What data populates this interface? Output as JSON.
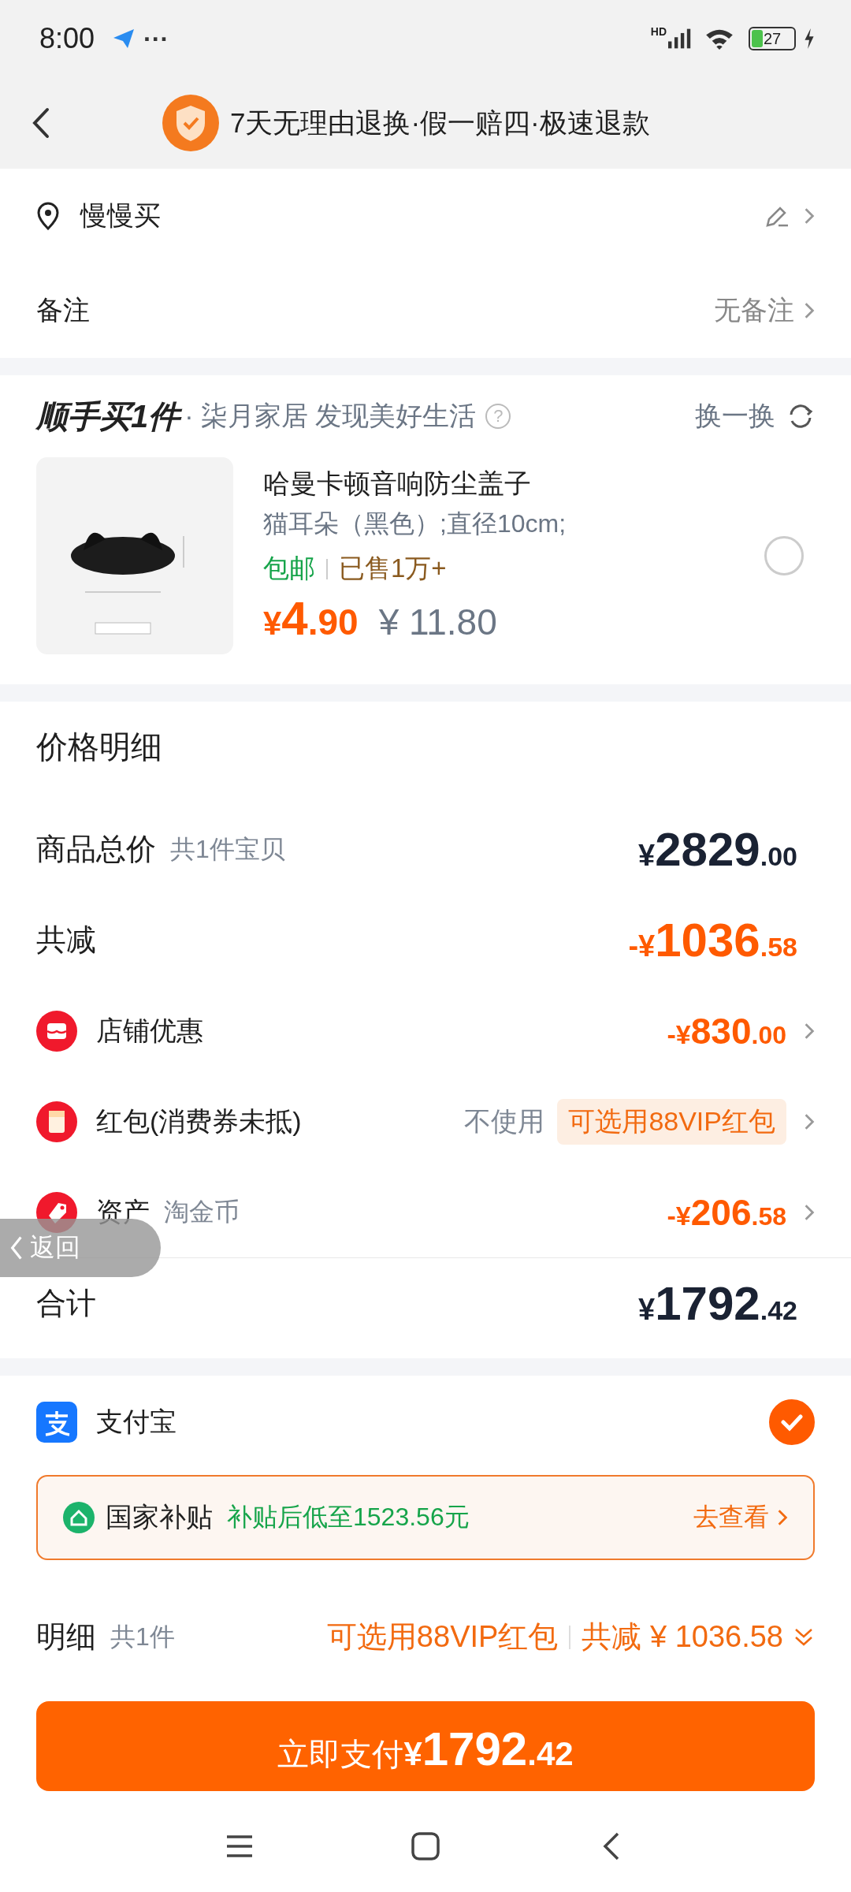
{
  "status_bar": {
    "time": "8:00",
    "more": "···",
    "network_label": "HD",
    "battery": "27"
  },
  "header": {
    "title": "7天无理由退换·假一赔四·极速退款"
  },
  "address": {
    "name": "慢慢买"
  },
  "remark": {
    "label": "备注",
    "value": "无备注"
  },
  "add_on": {
    "brand": "顺手买1件",
    "shop": "· 柒月家居 发现美好生活",
    "help": "?",
    "refresh": "换一换",
    "product": {
      "title": "哈曼卡顿音响防尘盖子",
      "spec": "猫耳朵（黑色）;直径10cm;",
      "shipping": "包邮",
      "sold": "已售1万+",
      "price": {
        "sign": "¥",
        "int": "4",
        "dec": ".90"
      },
      "original_price": "¥ 11.80",
      "selected": false
    }
  },
  "price_detail": {
    "title": "价格明细",
    "rows": [
      {
        "kind": "total",
        "label": "商品总价",
        "note": "共1件宝贝",
        "amount": {
          "sign": "¥",
          "int": "2829",
          "dec": ".00"
        }
      },
      {
        "kind": "discount",
        "label": "共减",
        "amount": {
          "sign": "-¥",
          "int": "1036",
          "dec": ".58"
        }
      },
      {
        "kind": "shop",
        "label": "店铺优惠",
        "amount": {
          "sign": "-¥",
          "int": "830",
          "dec": ".00"
        }
      },
      {
        "kind": "redpacket",
        "label": "红包(消费券未抵)",
        "note": "不使用",
        "tag": "可选用88VIP红包"
      },
      {
        "kind": "asset",
        "label": "资产",
        "note": "淘金币",
        "amount": {
          "sign": "-¥",
          "int": "206",
          "dec": ".58"
        }
      }
    ],
    "sum": {
      "label": "合计",
      "amount": {
        "sign": "¥",
        "int": "1792",
        "dec": ".42"
      }
    }
  },
  "payment": {
    "method": "支付宝",
    "selected": true,
    "subsidy": {
      "label": "国家补贴",
      "text": "补贴后低至1523.56元",
      "link": "去查看"
    }
  },
  "summary": {
    "label": "明细",
    "count": "共1件",
    "vip": "可选用88VIP红包",
    "saving": "共减 ¥ 1036.58"
  },
  "pay_button": {
    "label": "立即支付",
    "amount": {
      "sign": "¥",
      "int": "1792",
      "dec": ".42"
    }
  },
  "float_back": {
    "label": "返回"
  }
}
